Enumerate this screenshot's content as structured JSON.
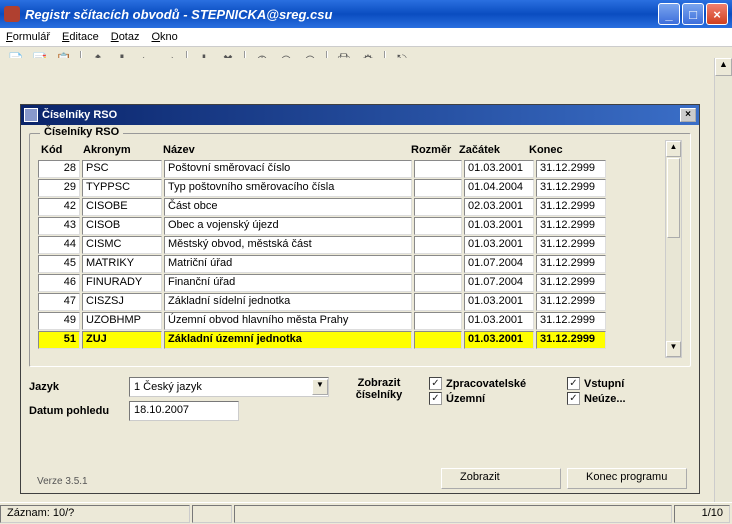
{
  "window": {
    "title": "Registr sčítacích obvodů - STEPNICKA@sreg.csu"
  },
  "menu": {
    "formular": "Formulář",
    "editace": "Editace",
    "dotaz": "Dotaz",
    "okno": "Okno"
  },
  "child": {
    "title": "Číselníky RSO",
    "group": "Číselníky RSO",
    "headers": {
      "kod": "Kód",
      "akronym": "Akronym",
      "nazev": "Název",
      "rozmer": "Rozměr",
      "zacatek": "Začátek",
      "konec": "Konec"
    },
    "rows": [
      {
        "kod": "28",
        "akr": "PSC",
        "naz": "Poštovní směrovací číslo",
        "roz": "",
        "zac": "01.03.2001",
        "kon": "31.12.2999"
      },
      {
        "kod": "29",
        "akr": "TYPPSC",
        "naz": "Typ poštovního směrovacího čísla",
        "roz": "",
        "zac": "01.04.2004",
        "kon": "31.12.2999"
      },
      {
        "kod": "42",
        "akr": "CISOBE",
        "naz": "Část obce",
        "roz": "",
        "zac": "02.03.2001",
        "kon": "31.12.2999"
      },
      {
        "kod": "43",
        "akr": "CISOB",
        "naz": "Obec a vojenský újezd",
        "roz": "",
        "zac": "01.03.2001",
        "kon": "31.12.2999"
      },
      {
        "kod": "44",
        "akr": "CISMC",
        "naz": "Městský obvod, městská část",
        "roz": "",
        "zac": "01.03.2001",
        "kon": "31.12.2999"
      },
      {
        "kod": "45",
        "akr": "MATRIKY",
        "naz": "Matriční úřad",
        "roz": "",
        "zac": "01.07.2004",
        "kon": "31.12.2999"
      },
      {
        "kod": "46",
        "akr": "FINURADY",
        "naz": "Finanční úřad",
        "roz": "",
        "zac": "01.07.2004",
        "kon": "31.12.2999"
      },
      {
        "kod": "47",
        "akr": "CISZSJ",
        "naz": "Základní sídelní jednotka",
        "roz": "",
        "zac": "01.03.2001",
        "kon": "31.12.2999"
      },
      {
        "kod": "49",
        "akr": "UZOBHMP",
        "naz": "Územní obvod hlavního města Prahy",
        "roz": "",
        "zac": "01.03.2001",
        "kon": "31.12.2999"
      },
      {
        "kod": "51",
        "akr": "ZUJ",
        "naz": "Základní územní jednotka",
        "roz": "",
        "zac": "01.03.2001",
        "kon": "31.12.2999",
        "selected": true
      }
    ],
    "jazyk_label": "Jazyk",
    "jazyk_value": "1 Český jazyk",
    "datum_label": "Datum pohledu",
    "datum_value": "18.10.2007",
    "zobrazit_label": "Zobrazit číselníky",
    "chk": {
      "zprac": "Zpracovatelské",
      "vstupni": "Vstupní",
      "uzemni": "Územní",
      "neuze": "Neúze..."
    },
    "btn_zobrazit": "Zobrazit",
    "btn_konec": "Konec programu",
    "verze": "Verze 3.5.1"
  },
  "status": {
    "record": "Záznam: 10/?",
    "pos": "1/10"
  }
}
